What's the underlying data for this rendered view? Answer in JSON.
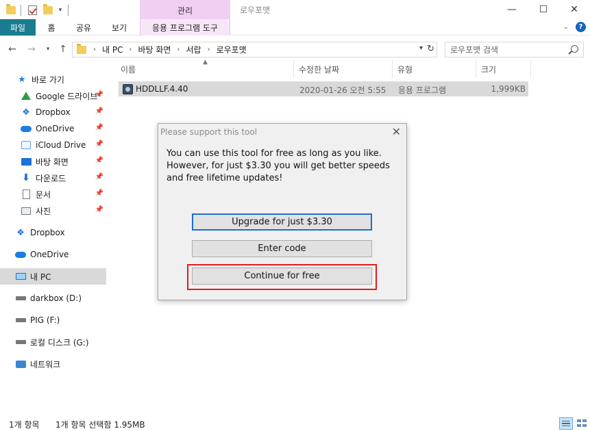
{
  "window": {
    "context_tab_header": "관리",
    "title": "로우포맷",
    "controls": {
      "minimize": "—",
      "maximize": "☐",
      "close": "✕"
    }
  },
  "ribbon": {
    "tabs": [
      {
        "label": "파일"
      },
      {
        "label": "홈"
      },
      {
        "label": "공유"
      },
      {
        "label": "보기"
      },
      {
        "label": "응용 프로그램 도구"
      }
    ],
    "help": "?"
  },
  "address": {
    "breadcrumbs": [
      "내 PC",
      "바탕 화면",
      "서랍",
      "로우포맷"
    ],
    "search_placeholder": "로우포맷 검색"
  },
  "sidebar": {
    "quick_access": "바로 가기",
    "pinned": [
      {
        "label": "Google 드라이브",
        "icon": "google-drive-icon"
      },
      {
        "label": "Dropbox",
        "icon": "dropbox-icon"
      },
      {
        "label": "OneDrive",
        "icon": "onedrive-icon"
      },
      {
        "label": "iCloud Drive",
        "icon": "icloud-drive-icon"
      },
      {
        "label": "바탕 화면",
        "icon": "desktop-icon"
      },
      {
        "label": "다운로드",
        "icon": "download-icon"
      },
      {
        "label": "문서",
        "icon": "document-icon"
      },
      {
        "label": "사진",
        "icon": "pictures-icon"
      }
    ],
    "locations": [
      {
        "label": "Dropbox",
        "icon": "dropbox-icon"
      },
      {
        "label": "OneDrive",
        "icon": "onedrive-icon"
      },
      {
        "label": "내 PC",
        "icon": "this-pc-icon",
        "selected": true
      },
      {
        "label": "darkbox (D:)",
        "icon": "drive-icon"
      },
      {
        "label": "PIG (F:)",
        "icon": "drive-icon"
      },
      {
        "label": "로컬 디스크 (G:)",
        "icon": "drive-icon"
      },
      {
        "label": "네트워크",
        "icon": "network-icon"
      }
    ]
  },
  "file_list": {
    "columns": [
      "이름",
      "수정한 날짜",
      "유형",
      "크기"
    ],
    "rows": [
      {
        "name": "HDDLLF.4.40",
        "modified": "2020-01-26 오전 5:55",
        "type": "응용 프로그램",
        "size": "1,999KB"
      }
    ]
  },
  "dialog": {
    "title": "Please support this tool",
    "message": "You can use this tool for free as long as you like. However, for just $3.30 you will get better speeds and free lifetime updates!",
    "buttons": {
      "upgrade": "Upgrade for just $3.30",
      "enter_code": "Enter code",
      "continue": "Continue for free"
    },
    "highlight_color": "#e31b1b"
  },
  "status": {
    "item_count": "1개 항목",
    "selection": "1개 항목 선택함 1.95MB"
  },
  "colors": {
    "file_tab": "#1a7d8f",
    "context_tab": "#f0d0f2",
    "selection": "#d9d9d9",
    "primary_border": "#1b6fd1"
  }
}
